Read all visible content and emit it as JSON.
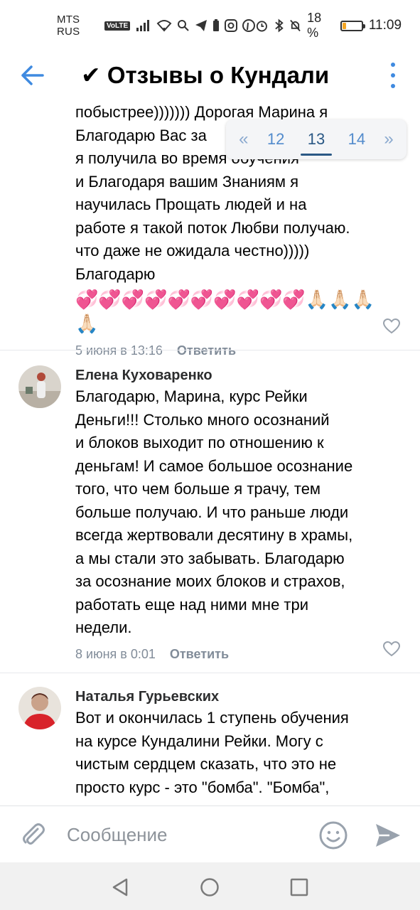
{
  "status_bar": {
    "carrier": "MTS RUS",
    "volte": "VoLTE",
    "battery_percent": "18 %",
    "battery_level": 0.18,
    "time": "11:09"
  },
  "header": {
    "title": "✔ Отзывы о Кундали"
  },
  "pagination": {
    "prev": "«",
    "pages": [
      "12",
      "13",
      "14"
    ],
    "active": "13",
    "next": "»"
  },
  "comments": [
    {
      "text": "побыстрее))))))) Дорогая Марина я\nБлагодарю Вас за\nя получила во время обучения\nи Благодаря вашим Знаниям я\nнаучилась Прощать людей и на\nработе я такой поток Любви получаю.\nчто даже не ожидала честно)))))\nБлагодарю",
      "emojis": "💞💞💞💞💞💞💞💞💞💞🙏🏻🙏🏻🙏🏻🙏🏻",
      "date": "5 июня в 13:16",
      "reply": "Ответить"
    },
    {
      "author": "Елена Куховаренко",
      "text": "Благодарю, Марина, курс Рейки\nДеньги!!! Столько много осознаний\nи блоков выходит по отношению к\nденьгам! И самое большое осознание\nтого, что чем больше я трачу, тем\nбольше получаю. И что раньше люди\nвсегда жертвовали десятину в храмы,\nа мы стали это забывать. Благодарю\nза осознание моих блоков и страхов,\nработать еще над ними мне три\nнедели.",
      "date": "8 июня в 0:01",
      "reply": "Ответить"
    },
    {
      "author": "Наталья Гурьевских",
      "text": "Вот и окончилась 1 ступень обучения\nна курсе Кундалини Рейки. Могу с\nчистым сердцем сказать, что это не\nпросто курс - это \"бомба\". \"Бомба\","
    }
  ],
  "composer": {
    "placeholder": "Сообщение"
  },
  "icons": {
    "back": "arrow-left-icon",
    "more": "dots-vertical-icon",
    "like": "heart-icon",
    "attach": "paperclip-icon",
    "emoji": "smile-icon",
    "send": "send-icon"
  },
  "colors": {
    "accent": "#2a5885",
    "link_blue": "#3f8ae0",
    "meta_gray": "#818c99",
    "battery": "#f5a623"
  }
}
